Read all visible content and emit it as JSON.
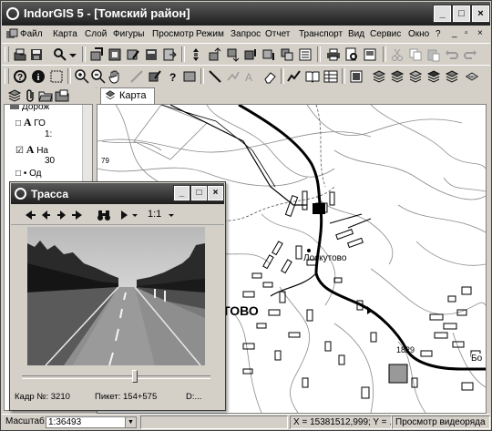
{
  "app": {
    "title": "IndorGIS 5 - [Томский район]",
    "window_buttons": [
      "_",
      "□",
      "×"
    ]
  },
  "menu": [
    {
      "label": "Файл"
    },
    {
      "label": "Карта"
    },
    {
      "label": "Слой"
    },
    {
      "label": "Фигуры"
    },
    {
      "label": "Просмотр"
    },
    {
      "label": "Режим"
    },
    {
      "label": "Запрос"
    },
    {
      "label": "Отчет"
    },
    {
      "label": "Транспорт"
    },
    {
      "label": "Вид"
    },
    {
      "label": "Сервис"
    },
    {
      "label": "Окно"
    },
    {
      "label": "?"
    }
  ],
  "map_tab": {
    "label": "Карта",
    "icon": "map-icon"
  },
  "layer_tree": {
    "rows": [
      {
        "checkbox": "",
        "icon": "",
        "label": "Дорож"
      },
      {
        "checkbox": "□",
        "icon": "A",
        "label": "ГО"
      },
      {
        "checkbox": "",
        "icon": "",
        "label": "1:"
      },
      {
        "checkbox": "☑",
        "icon": "A",
        "label": "На"
      },
      {
        "checkbox": "",
        "icon": "",
        "label": "30"
      },
      {
        "checkbox": "□",
        "icon": "•",
        "label": "Од"
      }
    ]
  },
  "map": {
    "labels": [
      {
        "text": "Лоскутово"
      },
      {
        "text": "ТОВО"
      },
      {
        "text": "1829"
      },
      {
        "text": "79"
      },
      {
        "text": "Бо"
      }
    ]
  },
  "video_window": {
    "title": "Трасса",
    "zoom": "1:1",
    "frame_label": "Кадр №: 3210",
    "picket_label": "Пикет: 154+575",
    "d_label": "D:...",
    "slider_position": 0.6
  },
  "statusbar": {
    "scale_label": "Масштаб:",
    "scale_value": "1:36493",
    "coords": "X = 15381512,999; Y = ...",
    "mode": "Просмотр видеоряда"
  },
  "colors": {
    "titlebar": "#2a2a2a",
    "chrome": "#d4d0c8",
    "map_bg": "#ffffff"
  }
}
